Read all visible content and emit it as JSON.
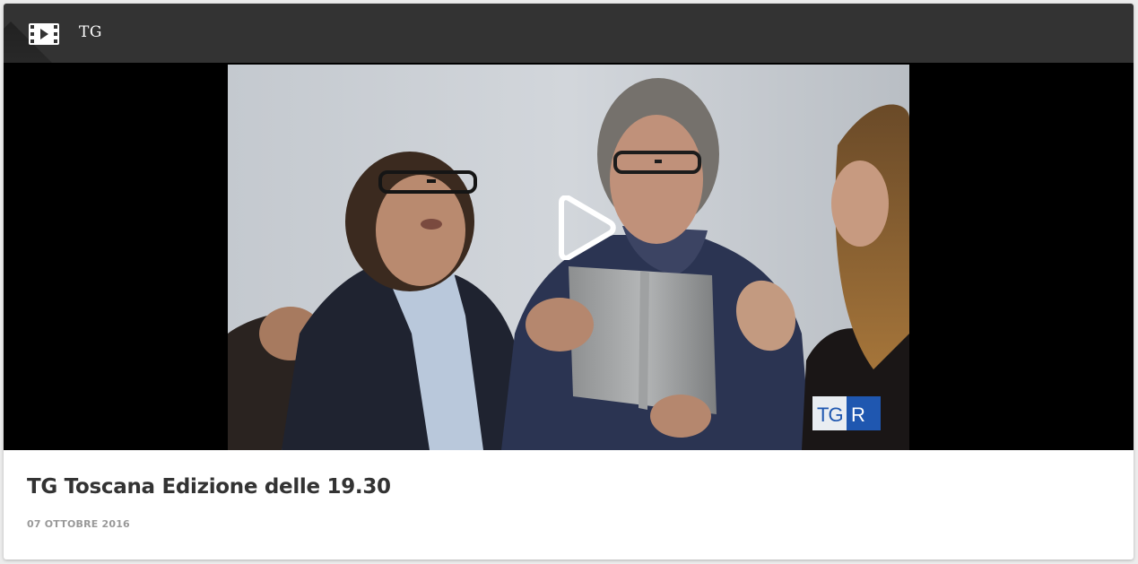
{
  "header": {
    "section_label": "TG",
    "icon": "film-icon"
  },
  "video": {
    "play_icon": "play-icon",
    "watermark_logo": "TGR",
    "colors": {
      "letterbox": "#000000",
      "logo_blue": "#1f57b0"
    }
  },
  "item": {
    "title": "TG Toscana Edizione delle 19.30",
    "date": "07 OTTOBRE 2016"
  },
  "colors": {
    "header_bg": "#333333",
    "title_text": "#333333",
    "date_text": "#999999"
  }
}
